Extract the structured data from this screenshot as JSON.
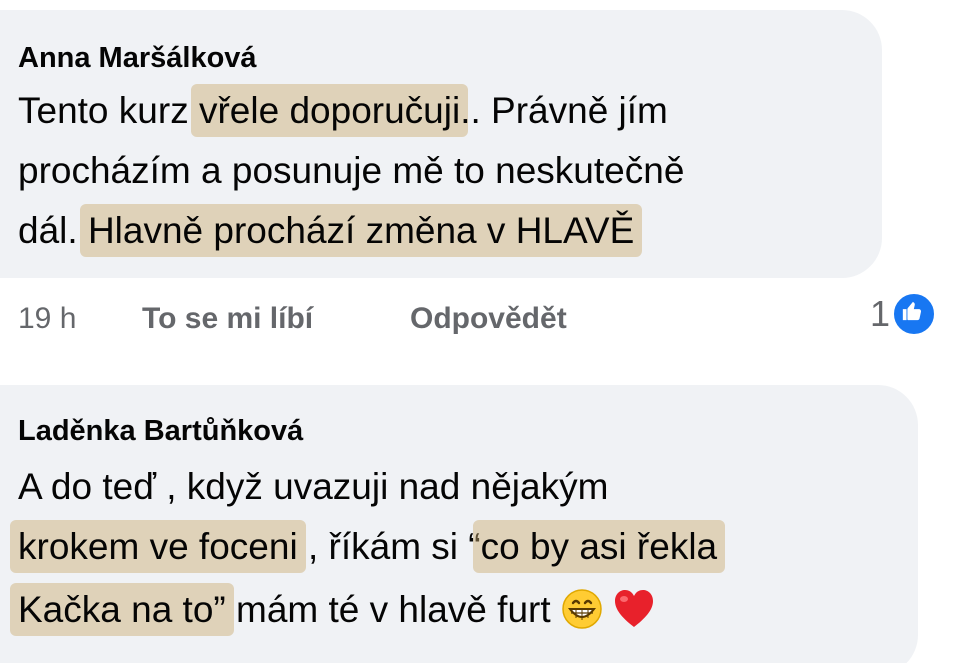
{
  "comments": [
    {
      "author": "Anna Maršálková",
      "line1_a": "Tento kurz ",
      "line1_hl": "vřele doporučuji",
      "line1_b": "..  Právně jím",
      "line2": "procházím a posunuje mě to neskutečně",
      "line3_a": "dál. ",
      "line3_hl": "Hlavně prochází změna v HLAVĚ",
      "time": "19 h",
      "like_label": "To se mi líbí",
      "reply_label": "Odpovědět",
      "reaction_count": "1"
    },
    {
      "author": "Laděnka Bartůňková",
      "line1": "A do teď , když uvazuji nad nějakým",
      "line2_hl1": "krokem ve foceni",
      "line2_mid": " , říkám si “",
      "line2_hl2": "co by asi řekla",
      "line3_hl": "Kačka na to”",
      "line3_b": " mám té v hlavě furt ",
      "emojis": [
        "grinning-face-emoji",
        "red-heart-emoji"
      ]
    }
  ],
  "colors": {
    "bubble": "#f0f2f5",
    "highlight": "#c9aa70",
    "like_blue": "#1877f2",
    "secondary_text": "#65676b"
  }
}
